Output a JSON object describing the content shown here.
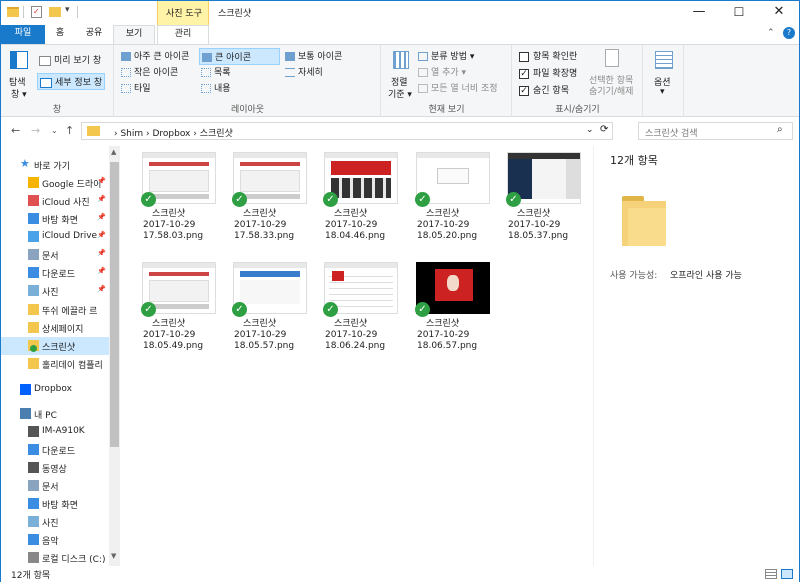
{
  "window": {
    "title": "스크린샷",
    "context_tab_group": "사진 도구",
    "controls": {
      "minimize": "—",
      "maximize": "☐",
      "close": "✕"
    }
  },
  "tabs": {
    "file": "파일",
    "home": "홈",
    "share": "공유",
    "view": "보기",
    "manage": "관리"
  },
  "ribbon": {
    "pane": {
      "nav_pane": "탐색\n창",
      "nav_pane_l1": "탐색",
      "nav_pane_l2": "창 ▾",
      "preview": "미리 보기 창",
      "details": "세부 정보 창",
      "label": "창"
    },
    "layout": {
      "xlarge": "아주 큰 아이콘",
      "large": "큰 아이콘",
      "medium": "보통 아이콘",
      "small": "작은 아이콘",
      "list": "목록",
      "details": "자세히",
      "tiles": "타일",
      "content": "내용",
      "label": "레이아웃"
    },
    "current_view": {
      "sort_l1": "정렬",
      "sort_l2": "기준 ▾",
      "group_by": "분류 방법 ▾",
      "add_cols": "열 추가 ▾",
      "size_all": "모든 열 너비 조정",
      "label": "현재 보기"
    },
    "showhide": {
      "item_check": "항목 확인란",
      "extensions": "파일 확장명",
      "hidden": "숨긴 항목",
      "hide_sel_l1": "선택한 항목",
      "hide_sel_l2": "숨기기/해제",
      "label": "표시/숨기기"
    },
    "options": {
      "l1": "옵션",
      "l2": "▾"
    }
  },
  "address": {
    "path": "›  Shim  ›  Dropbox  ›  스크린샷",
    "search_placeholder": "스크린샷 검색"
  },
  "sidebar": {
    "items": [
      {
        "label": "바로 가기",
        "icon": "star-icon",
        "pinned": false,
        "indent": 0
      },
      {
        "label": "Google 드라이",
        "icon": "google-drive-icon",
        "pinned": true,
        "indent": 1
      },
      {
        "label": "iCloud 사진",
        "icon": "icloud-photos-icon",
        "pinned": true,
        "indent": 1
      },
      {
        "label": "바탕 화면",
        "icon": "desktop-icon",
        "pinned": true,
        "indent": 1
      },
      {
        "label": "iCloud Drive",
        "icon": "icloud-drive-icon",
        "pinned": true,
        "indent": 1
      },
      {
        "label": "문서",
        "icon": "documents-icon",
        "pinned": true,
        "indent": 1
      },
      {
        "label": "다운로드",
        "icon": "downloads-icon",
        "pinned": true,
        "indent": 1
      },
      {
        "label": "사진",
        "icon": "pictures-icon",
        "pinned": true,
        "indent": 1
      },
      {
        "label": "뚜쉬 에끌라 르",
        "icon": "folder-icon",
        "pinned": false,
        "indent": 1
      },
      {
        "label": "상세페이지",
        "icon": "folder-icon",
        "pinned": false,
        "indent": 1
      },
      {
        "label": "스크린샷",
        "icon": "folder-synced-icon",
        "pinned": false,
        "indent": 1,
        "selected": true
      },
      {
        "label": "홀리데이 컴플리",
        "icon": "folder-icon",
        "pinned": false,
        "indent": 1
      },
      {
        "label": "Dropbox",
        "icon": "dropbox-icon",
        "pinned": false,
        "indent": 0
      },
      {
        "label": "내 PC",
        "icon": "pc-icon",
        "pinned": false,
        "indent": 0
      },
      {
        "label": "IM-A910K",
        "icon": "phone-icon",
        "pinned": false,
        "indent": 1
      },
      {
        "label": "다운로드",
        "icon": "downloads-icon",
        "pinned": false,
        "indent": 1
      },
      {
        "label": "동영상",
        "icon": "videos-icon",
        "pinned": false,
        "indent": 1
      },
      {
        "label": "문서",
        "icon": "documents-icon",
        "pinned": false,
        "indent": 1
      },
      {
        "label": "바탕 화면",
        "icon": "desktop-icon",
        "pinned": false,
        "indent": 1
      },
      {
        "label": "사진",
        "icon": "pictures-icon",
        "pinned": false,
        "indent": 1
      },
      {
        "label": "음악",
        "icon": "music-icon",
        "pinned": false,
        "indent": 1
      },
      {
        "label": "로컬 디스크 (C:)",
        "icon": "disk-icon",
        "pinned": false,
        "indent": 1
      }
    ]
  },
  "files": [
    {
      "l1": "스크린샷",
      "l2": "2017-10-29",
      "l3": "17.58.03.png",
      "thumb": "web-light"
    },
    {
      "l1": "스크린샷",
      "l2": "2017-10-29",
      "l3": "17.58.33.png",
      "thumb": "web-light"
    },
    {
      "l1": "스크린샷",
      "l2": "2017-10-29",
      "l3": "18.04.46.png",
      "thumb": "web-red"
    },
    {
      "l1": "스크린샷",
      "l2": "2017-10-29",
      "l3": "18.05.20.png",
      "thumb": "web-blank"
    },
    {
      "l1": "스크린샷",
      "l2": "2017-10-29",
      "l3": "18.05.37.png",
      "thumb": "web-dark"
    },
    {
      "l1": "스크린샷",
      "l2": "2017-10-29",
      "l3": "18.05.49.png",
      "thumb": "web-light"
    },
    {
      "l1": "스크린샷",
      "l2": "2017-10-29",
      "l3": "18.05.57.png",
      "thumb": "web-blue"
    },
    {
      "l1": "스크린샷",
      "l2": "2017-10-29",
      "l3": "18.06.24.png",
      "thumb": "web-grid"
    },
    {
      "l1": "스크린샷",
      "l2": "2017-10-29",
      "l3": "18.06.57.png",
      "thumb": "photo-red"
    }
  ],
  "details_pane": {
    "count": "12개 항목",
    "availability_label": "사용 가능성:",
    "availability_value": "오프라인 사용 가능"
  },
  "status": {
    "count": "12개 항목"
  }
}
